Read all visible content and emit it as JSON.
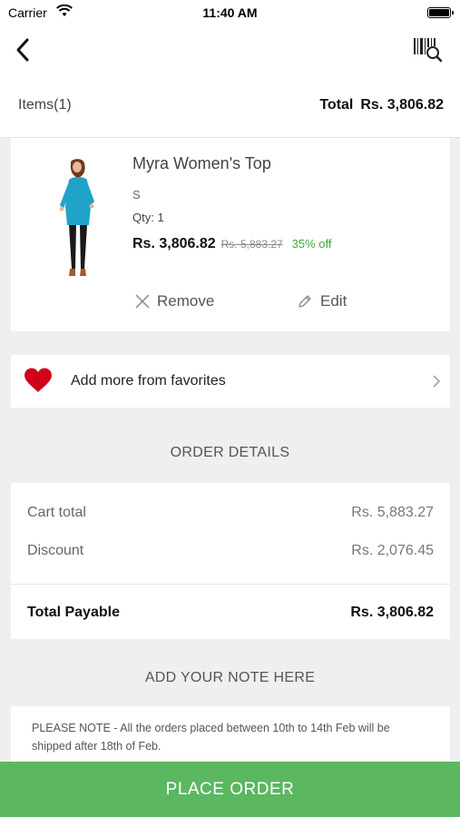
{
  "status_bar": {
    "carrier": "Carrier",
    "time": "11:40 AM"
  },
  "nav": {
    "back_icon": "back-arrow-icon",
    "barcode_icon": "barcode-search-icon"
  },
  "cart_header": {
    "items_label": "Items",
    "items_count": "(1)",
    "total_label": "Total",
    "total_value": "Rs. 3,806.82"
  },
  "product": {
    "name": "Myra Women's Top",
    "size": "S",
    "qty": "Qty: 1",
    "price": "Rs. 3,806.82",
    "original_price": "Rs. 5,883.27",
    "discount": "35% off",
    "remove_label": "Remove",
    "edit_label": "Edit"
  },
  "favorites": {
    "label": "Add more from favorites",
    "icon": "heart-icon"
  },
  "order_details": {
    "title": "ORDER DETAILS",
    "cart_total_label": "Cart total",
    "cart_total_value": "Rs. 5,883.27",
    "discount_label": "Discount",
    "discount_value": "Rs. 2,076.45",
    "payable_label": "Total Payable",
    "payable_value": "Rs. 3,806.82"
  },
  "note": {
    "title": "ADD YOUR NOTE HERE",
    "text": "PLEASE NOTE - All the orders placed between 10th to 14th Feb will be shipped after 18th of Feb."
  },
  "place_order_label": "PLACE ORDER",
  "colors": {
    "accent_green": "#5bb760",
    "discount_green": "#3ca83c",
    "heart_red": "#d0021b"
  }
}
